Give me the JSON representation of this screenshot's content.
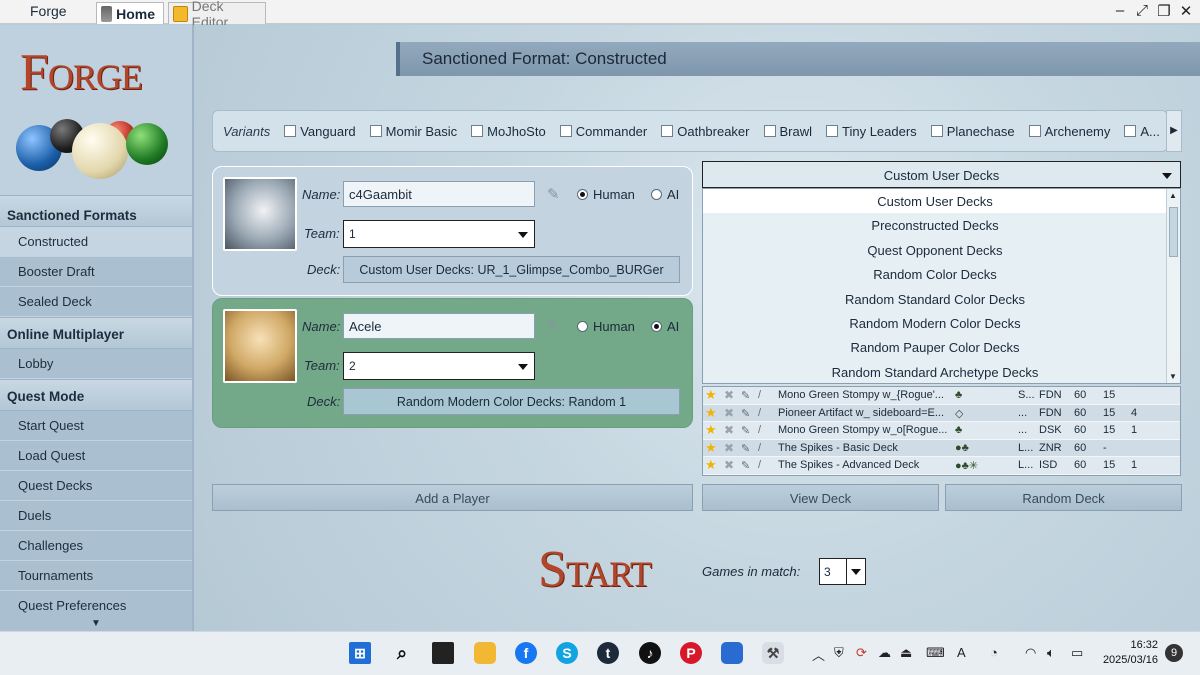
{
  "window": {
    "app_title": "Forge",
    "tabs": [
      {
        "label": "Home"
      },
      {
        "label": "Deck Editor"
      }
    ]
  },
  "sidebar": {
    "logo_text": "Forge",
    "sections": [
      {
        "header": "Sanctioned Formats",
        "items": [
          "Constructed",
          "Booster Draft",
          "Sealed Deck"
        ],
        "selected": "Constructed"
      },
      {
        "header": "Online Multiplayer",
        "items": [
          "Lobby"
        ]
      },
      {
        "header": "Quest Mode",
        "items": [
          "Start Quest",
          "Load Quest",
          "Quest Decks",
          "Duels",
          "Challenges",
          "Tournaments",
          "Quest Preferences"
        ]
      }
    ]
  },
  "format_header": "Sanctioned Format: Constructed",
  "variants": {
    "label": "Variants",
    "items": [
      "Vanguard",
      "Momir Basic",
      "MoJhoSto",
      "Commander",
      "Oathbreaker",
      "Brawl",
      "Tiny Leaders",
      "Planechase",
      "Archenemy",
      "A..."
    ]
  },
  "players": [
    {
      "name_label": "Name:",
      "name": "c4Gaambit",
      "team_label": "Team:",
      "team": "1",
      "deck_label": "Deck:",
      "deck": "Custom User Decks: UR_1_Glimpse_Combo_BURGer",
      "radio_human": "Human",
      "radio_ai": "AI",
      "type": "Human"
    },
    {
      "name_label": "Name:",
      "name": "Acele",
      "team_label": "Team:",
      "team": "2",
      "deck_label": "Deck:",
      "deck": "Random Modern Color Decks: Random 1",
      "radio_human": "Human",
      "radio_ai": "AI",
      "type": "AI"
    }
  ],
  "add_player_label": "Add a Player",
  "deck_type": {
    "selected": "Custom User Decks",
    "options": [
      "Custom User Decks",
      "Preconstructed Decks",
      "Quest Opponent Decks",
      "Random Color Decks",
      "Random Standard Color Decks",
      "Random Modern Color Decks",
      "Random Pauper Color Decks",
      "Random Standard Archetype Decks"
    ]
  },
  "decks_table": [
    {
      "name": "Mono Green Stompy w_{Rogue'...",
      "colors": "♣",
      "f": "S...",
      "set": "FDN",
      "main": "60",
      "side": "15",
      "extra": ""
    },
    {
      "name": "Pioneer Artifact w_ sideboard=E...",
      "colors": "◇",
      "f": "...",
      "set": "FDN",
      "main": "60",
      "side": "15",
      "extra": "4"
    },
    {
      "name": "Mono Green Stompy w_o[Rogue...",
      "colors": "♣",
      "f": "...",
      "set": "DSK",
      "main": "60",
      "side": "15",
      "extra": "1"
    },
    {
      "name": "The Spikes - Basic Deck",
      "colors": "●♣",
      "f": "L...",
      "set": "ZNR",
      "main": "60",
      "side": "-",
      "extra": ""
    },
    {
      "name": "The Spikes - Advanced Deck",
      "colors": "●♣✳",
      "f": "L...",
      "set": "ISD",
      "main": "60",
      "side": "15",
      "extra": "1"
    }
  ],
  "view_deck_label": "View Deck",
  "random_deck_label": "Random Deck",
  "start_label": "Start",
  "games_in_match_label": "Games in match:",
  "games_in_match_value": "3",
  "taskbar": {
    "time": "16:32",
    "date": "2025/03/16",
    "notifications": "9"
  }
}
